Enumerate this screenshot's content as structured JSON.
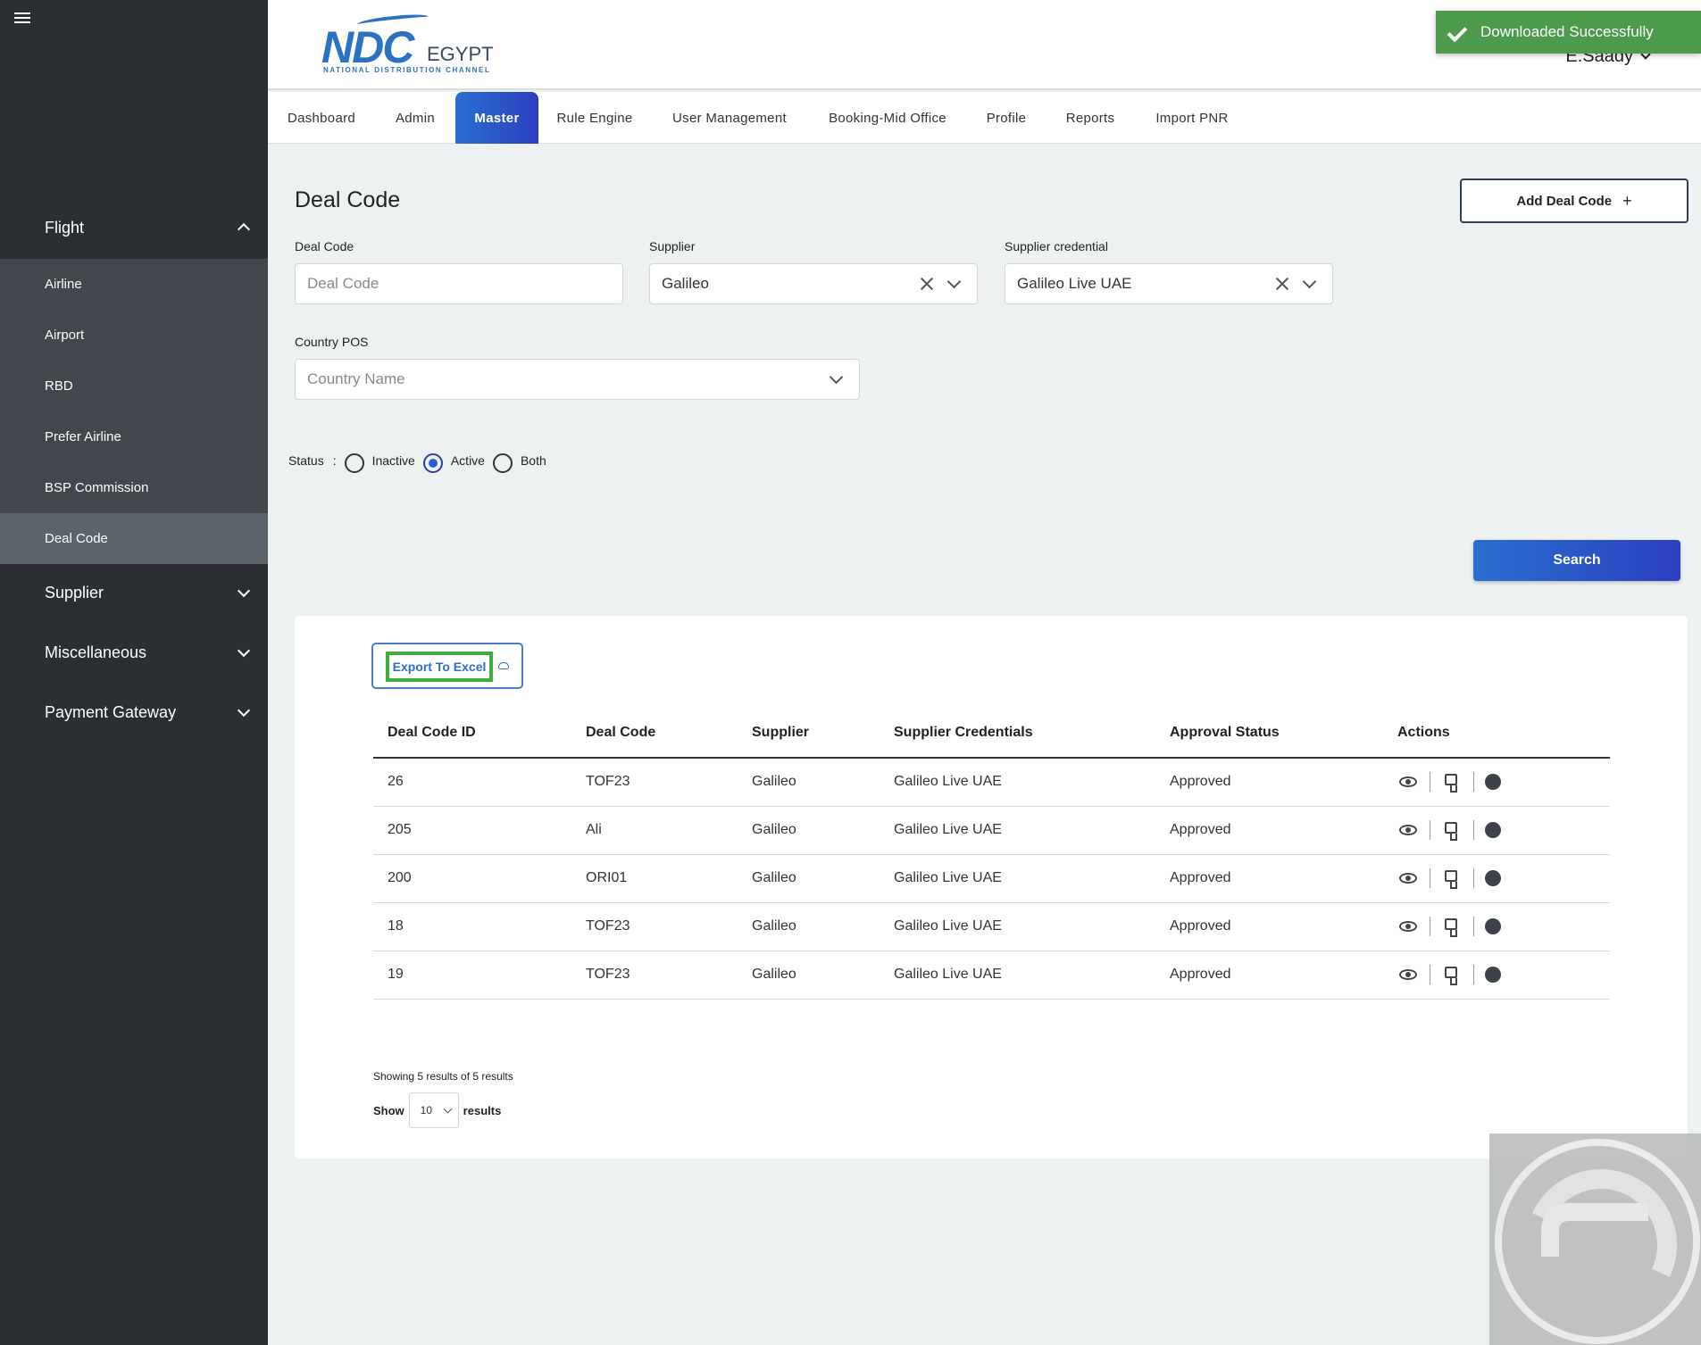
{
  "sidebar": {
    "groups": {
      "flight": "Flight",
      "supplier": "Supplier",
      "miscellaneous": "Miscellaneous",
      "payment_gateway": "Payment Gateway"
    },
    "flight_items": [
      "Airline",
      "Airport",
      "RBD",
      "Prefer Airline",
      "BSP Commission",
      "Deal Code"
    ],
    "active_item": "Deal Code"
  },
  "header": {
    "logo": {
      "main": "NDC",
      "sub": "EGYPT",
      "tagline": "NATIONAL DISTRIBUTION CHANNEL"
    },
    "user_name": "E.Saady"
  },
  "toast": {
    "message": "Downloaded Successfully",
    "color": "#4c9a4c"
  },
  "tabs": [
    "Dashboard",
    "Admin",
    "Master",
    "Rule Engine",
    "User Management",
    "Booking-Mid Office",
    "Profile",
    "Reports",
    "Import PNR"
  ],
  "active_tab": "Master",
  "page": {
    "title": "Deal Code",
    "add_button": "Add Deal Code",
    "filters": {
      "deal_code": {
        "label": "Deal Code",
        "placeholder": "Deal Code",
        "value": ""
      },
      "supplier": {
        "label": "Supplier",
        "value": "Galileo"
      },
      "supplier_credential": {
        "label": "Supplier credential",
        "value": "Galileo Live UAE"
      },
      "country_pos": {
        "label": "Country POS",
        "placeholder": "Country Name"
      }
    },
    "status": {
      "label": "Status",
      "separator": ":",
      "options": [
        "Inactive",
        "Active",
        "Both"
      ],
      "selected": "Active"
    },
    "search_button": "Search"
  },
  "results": {
    "export_button": "Export To Excel",
    "columns": [
      "Deal Code ID",
      "Deal Code",
      "Supplier",
      "Supplier Credentials",
      "Approval Status",
      "Actions"
    ],
    "rows": [
      [
        "26",
        "TOF23",
        "Galileo",
        "Galileo Live UAE",
        "Approved"
      ],
      [
        "205",
        "Ali",
        "Galileo",
        "Galileo Live UAE",
        "Approved"
      ],
      [
        "200",
        "ORI01",
        "Galileo",
        "Galileo Live UAE",
        "Approved"
      ],
      [
        "18",
        "TOF23",
        "Galileo",
        "Galileo Live UAE",
        "Approved"
      ],
      [
        "19",
        "TOF23",
        "Galileo",
        "Galileo Live UAE",
        "Approved"
      ]
    ],
    "row_actions": [
      "view-icon",
      "thumbs-down-icon",
      "status-dot-icon"
    ],
    "showing_text": "Showing 5 results of 5 results",
    "show_label": "Show",
    "page_size": "10",
    "results_label": "results"
  },
  "colors": {
    "sidebar_bg": "#2b2f33",
    "accent_blue": "#2b6fd0",
    "toast_green": "#4c9a4c",
    "export_highlight": "#3fae3f"
  }
}
